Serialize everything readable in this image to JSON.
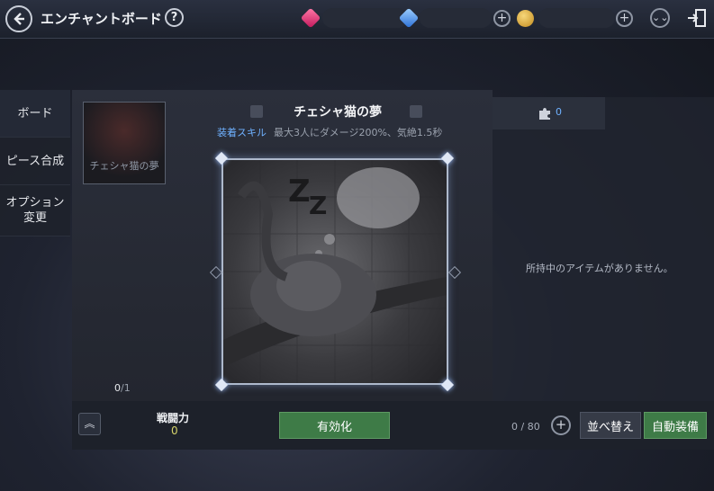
{
  "header": {
    "title": "エンチャントボード",
    "help_label": "?",
    "plus_label": "+",
    "icons": [
      "back-arrow-icon",
      "help-icon",
      "red-gem-icon",
      "blue-gem-icon",
      "gold-coin-icon",
      "plus-icon",
      "double-chevron-down-icon",
      "exit-door-icon"
    ]
  },
  "sidebar": {
    "items": [
      {
        "label": "ボード"
      },
      {
        "label": "ピース合成"
      },
      {
        "label": "オプション\n変更"
      }
    ]
  },
  "board": {
    "thumbnail_label": "チェシャ猫の夢",
    "title": "チェシャ猫の夢",
    "skill_tag": "装着スキル",
    "skill_desc": "最大3人にダメージ200%、気絶1.5秒",
    "count_current": "0",
    "count_max": "/1"
  },
  "inventory": {
    "tab_count": "0",
    "empty_message": "所持中のアイテムがありません。",
    "slots": "0 / 80"
  },
  "bottom": {
    "power_label": "戦闘力",
    "power_value": "0",
    "activate_label": "有効化",
    "sort_label": "並べ替え",
    "auto_equip_label": "自動装備",
    "add_label": "+"
  },
  "colors": {
    "accent_blue": "#6fb1ff",
    "button_green": "#3e7b47",
    "power_yellow": "#d5d36a"
  }
}
